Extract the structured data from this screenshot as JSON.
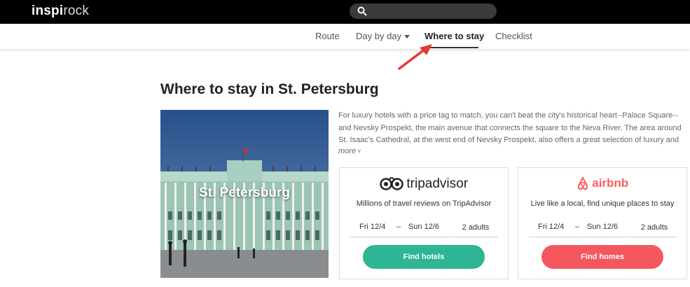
{
  "header": {
    "logo_bold": "inspi",
    "logo_light": "rock",
    "search_placeholder": ""
  },
  "nav": {
    "items": [
      "Route",
      "Day by day",
      "Where to stay",
      "Checklist"
    ],
    "active": "Where to stay"
  },
  "main": {
    "title": "Where to stay in St. Petersburg",
    "photo_label": "St. Petersburg",
    "description": "For luxury hotels with a price tag to match, you can't beat the city's historical heart--Palace Square--and Nevsky Prospekt, the main avenue that connects the square to the Neva River. The area around St. Isaac's Cathedral, at the west end of Nevsky Prospekt, also offers a great selection of luxury and",
    "more_label": "more"
  },
  "cards": [
    {
      "brand": "tripadvisor",
      "tagline": "Millions of travel reviews on TripAdvisor",
      "checkin": "Fri 12/4",
      "dash": "–",
      "checkout": "Sun 12/6",
      "guests": "2 adults",
      "button": "Find hotels"
    },
    {
      "brand": "airbnb",
      "tagline": "Live like a local, find unique places to stay",
      "checkin": "Fri 12/4",
      "dash": "–",
      "checkout": "Sun 12/6",
      "guests": "2 adults",
      "button": "Find homes"
    }
  ],
  "colors": {
    "accent_green": "#2db594",
    "accent_red": "#f4585e",
    "annotation_arrow": "#e53935"
  }
}
